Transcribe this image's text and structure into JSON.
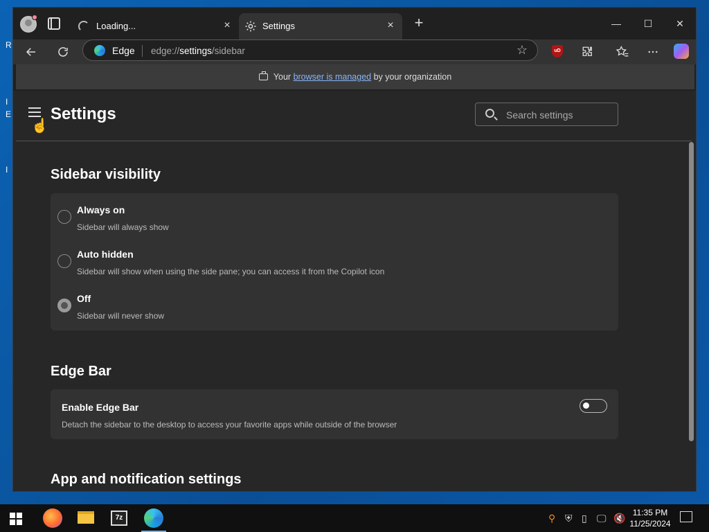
{
  "browser": {
    "tabs": [
      {
        "label": "Loading...",
        "close": "×"
      },
      {
        "label": "Settings",
        "close": "×"
      }
    ],
    "new_tab": "+",
    "window_controls": {
      "minimize": "—",
      "maximize": "☐",
      "close": "✕"
    }
  },
  "toolbar": {
    "site_name": "Edge",
    "url_prefix": "edge://",
    "url_page": "settings",
    "url_suffix": "/sidebar",
    "ublock_label": "uD"
  },
  "banner": {
    "prefix": "Your ",
    "link": "browser is managed",
    "suffix": " by your organization"
  },
  "settings": {
    "title": "Settings",
    "search_placeholder": "Search settings",
    "sidebar_visibility": {
      "title": "Sidebar visibility",
      "options": [
        {
          "title": "Always on",
          "desc": "Sidebar will always show",
          "checked": false
        },
        {
          "title": "Auto hidden",
          "desc": "Sidebar will show when using the side pane; you can access it from the Copilot icon",
          "checked": false
        },
        {
          "title": "Off",
          "desc": "Sidebar will never show",
          "checked": true
        }
      ]
    },
    "edge_bar": {
      "title": "Edge Bar",
      "toggle_title": "Enable Edge Bar",
      "toggle_desc": "Detach the sidebar to the desktop to access your favorite apps while outside of the browser",
      "enabled": false
    },
    "app_notifications": {
      "title": "App and notification settings"
    }
  },
  "taskbar": {
    "sevenzip_label": "7z",
    "clock_time": "11:35 PM",
    "clock_date": "11/25/2024"
  }
}
